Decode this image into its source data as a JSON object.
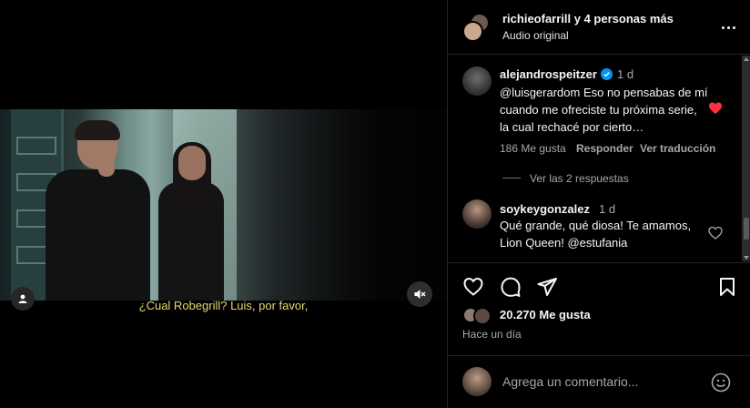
{
  "video": {
    "subtitle": "¿Cual Robegrill? Luis, por favor,",
    "user_tag_icon": "person-icon",
    "mute_icon": "speaker-muted-icon"
  },
  "header": {
    "title": "richieofarrill y 4 personas más",
    "audio": "Audio original",
    "more_icon": "more-horizontal-icon"
  },
  "comments": [
    {
      "username": "alejandrospeitzer",
      "verified": true,
      "time": "1 d",
      "text": "@luisgerardom Eso no pensabas de mí cuando me ofreciste tu próxima serie, la cual rechacé por cierto…",
      "likes": "186 Me gusta",
      "reply": "Responder",
      "translate": "Ver traducción",
      "liked": true,
      "replies": "Ver las 2 respuestas"
    },
    {
      "username": "soykeygonzalez",
      "verified": false,
      "time": "1 d",
      "text": "Qué grande, qué diosa! Te amamos, Lion Queen! @estufania",
      "liked": false
    }
  ],
  "actions": {
    "like_icon": "heart-icon",
    "comment_icon": "comment-icon",
    "share_icon": "send-icon",
    "save_icon": "bookmark-icon",
    "likes": "20.270 Me gusta",
    "time": "Hace un día"
  },
  "comment_box": {
    "placeholder": "Agrega un comentario...",
    "emoji_icon": "emoji-icon"
  },
  "colors": {
    "background": "#000000",
    "text": "#f5f5f5",
    "secondary": "#a8a8a8",
    "liked_heart": "#ff3040",
    "verified": "#0095f6",
    "subtitle": "#e9d86d"
  }
}
